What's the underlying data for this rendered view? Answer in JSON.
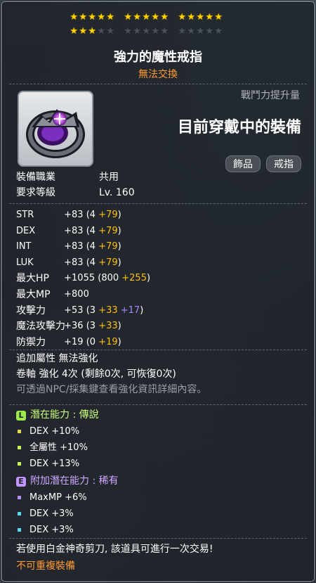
{
  "stars": {
    "total": 25,
    "filled": 18
  },
  "item": {
    "name": "強力的魔性戒指",
    "trade_note": "無法交換"
  },
  "power_label": "戰鬥力提升量",
  "equipped_text": "目前穿戴中的裝備",
  "tags": [
    "飾品",
    "戒指"
  ],
  "requirements": [
    {
      "label": "裝備職業",
      "value": "共用"
    },
    {
      "label": "要求等級",
      "value": "Lv. 160"
    }
  ],
  "stats": [
    {
      "name": "STR",
      "base": " +83 (4 ",
      "bonus": "+79",
      "bonus2": "",
      "tail": ")"
    },
    {
      "name": "DEX",
      "base": " +83 (4 ",
      "bonus": "+79",
      "bonus2": "",
      "tail": ")"
    },
    {
      "name": "INT",
      "base": " +83 (4 ",
      "bonus": "+79",
      "bonus2": "",
      "tail": ")"
    },
    {
      "name": "LUK",
      "base": " +83 (4 ",
      "bonus": "+79",
      "bonus2": "",
      "tail": ")"
    },
    {
      "name": "最大HP",
      "base": " +1055 (800 ",
      "bonus": "+255",
      "bonus2": "",
      "tail": ")"
    },
    {
      "name": "最大MP",
      "base": " +800",
      "bonus": "",
      "bonus2": "",
      "tail": ""
    },
    {
      "name": "攻擊力",
      "base": " +53 (3 ",
      "bonus": "+33",
      "bonus2": " +17",
      "tail": ")"
    },
    {
      "name": "魔法攻擊力",
      "base": " +36 (3 ",
      "bonus": "+33",
      "bonus2": "",
      "tail": ")"
    },
    {
      "name": "防禦力",
      "base": " +19 (0 ",
      "bonus": "+19",
      "bonus2": "",
      "tail": ")"
    }
  ],
  "extra": {
    "attr": "追加屬性 無法強化",
    "scroll": "卷軸 強化 4次 (剩餘0次, 可恢復0次)",
    "hint": "可透過NPC/採集鍵查看強化資訊詳細內容。"
  },
  "potential": {
    "title": "潛在能力 : 傳說",
    "badge": "L",
    "lines": [
      "DEX +10%",
      "全屬性 +10%",
      "DEX +13%"
    ]
  },
  "additional_potential": {
    "title": "附加潛在能力 : 稀有",
    "badge": "E",
    "lines": [
      "MaxMP +6%",
      "DEX +3%",
      "DEX +3%"
    ]
  },
  "footer": {
    "scissors": "若使用白金神奇剪刀, 該道具可進行一次交易!",
    "no_duplicate": "不可重複裝備"
  },
  "colors": {
    "orange": "#ff9a32",
    "gold": "#ffc000",
    "legend_green": "#9de84b",
    "unique_purple": "#c394ff"
  }
}
